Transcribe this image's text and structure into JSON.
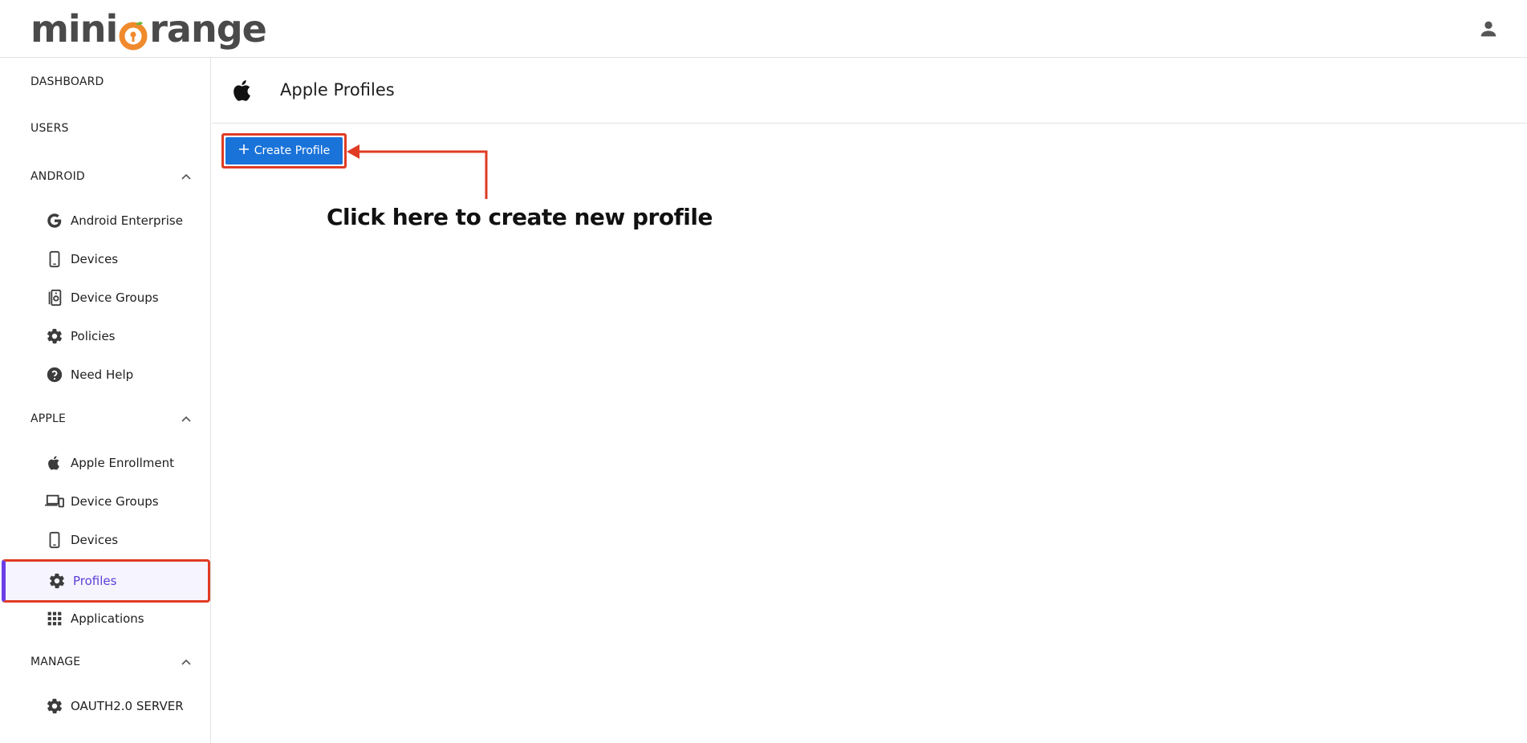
{
  "app": {
    "logo_text_left": "mini",
    "logo_text_right": "range"
  },
  "sidebar": {
    "dashboard": "DASHBOARD",
    "users": "USERS",
    "android": {
      "label": "ANDROID",
      "items": [
        {
          "label": "Android Enterprise",
          "icon": "google-icon"
        },
        {
          "label": "Devices",
          "icon": "phone-icon"
        },
        {
          "label": "Device Groups",
          "icon": "device-groups-icon"
        },
        {
          "label": "Policies",
          "icon": "gear-icon"
        },
        {
          "label": "Need Help",
          "icon": "help-icon"
        }
      ]
    },
    "apple": {
      "label": "APPLE",
      "items": [
        {
          "label": "Apple Enrollment",
          "icon": "apple-icon"
        },
        {
          "label": "Device Groups",
          "icon": "devices-icon"
        },
        {
          "label": "Devices",
          "icon": "phone-icon"
        },
        {
          "label": "Profiles",
          "icon": "gear-icon"
        },
        {
          "label": "Applications",
          "icon": "apps-grid-icon"
        }
      ]
    },
    "manage": {
      "label": "MANAGE",
      "items": [
        {
          "label": "OAUTH2.0 SERVER",
          "icon": "gear-icon"
        }
      ]
    }
  },
  "main": {
    "title": "Apple Profiles",
    "create_button": "Create Profile",
    "annotation": "Click here to create new profile"
  },
  "colors": {
    "accent": "#1a73d9",
    "highlight": "#e03b24",
    "active_text": "#5b3fd6",
    "logo_orange": "#f08a2c"
  }
}
